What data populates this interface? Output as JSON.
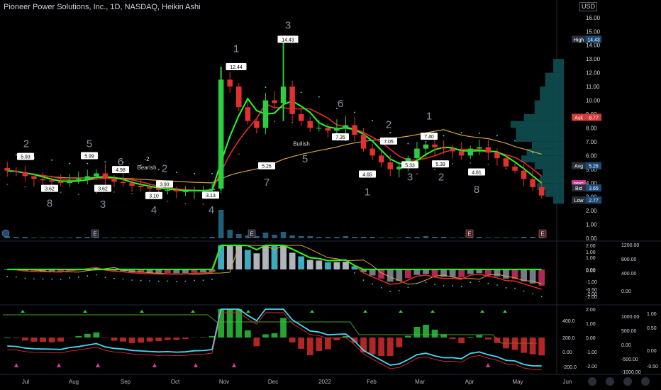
{
  "header": {
    "title": "Pioneer Power Solutions, Inc., 1D, NASDAQ, Heikin Ashi",
    "currency": "USD"
  },
  "colors": {
    "background": "#000000",
    "up": "#2ecc40",
    "down": "#e03030",
    "ma_green": "#22ff22",
    "ma_red": "#e52b2b",
    "ma_orange": "#d6a444",
    "dots_cyan": "#48c8e0",
    "dots_red": "#d03030",
    "volume_profile": "#0e4f52",
    "label_blue": "#1e4a78",
    "label_red": "#d43b3b",
    "label_pink": "#d93a9a",
    "label_gray": "#2a2e39"
  },
  "chart_data": [
    {
      "type": "candlestick",
      "name": "main",
      "style": "Heikin Ashi",
      "ylim": [
        0,
        16.5
      ],
      "y_ticks": [
        "16.00",
        "15.00",
        "14.00",
        "13.00",
        "12.00",
        "11.00",
        "10.00",
        "9.00",
        "8.00",
        "7.00",
        "6.00",
        "5.00",
        "4.00",
        "3.00",
        "2.00",
        "1.00",
        "0.00"
      ],
      "x_ticks": [
        "Jul",
        "Aug",
        "Sep",
        "Oct",
        "Nov",
        "Dec",
        "2022",
        "Feb",
        "Mar",
        "Apr",
        "May",
        "Jun"
      ],
      "price_close": [
        4.9,
        4.8,
        4.5,
        4.3,
        4.2,
        4.1,
        4.0,
        4.2,
        4.3,
        4.5,
        4.7,
        4.3,
        4.1,
        4.0,
        3.8,
        3.7,
        3.6,
        3.5,
        3.5,
        3.4,
        3.4,
        3.5,
        3.5,
        3.6,
        11.5,
        11.0,
        9.5,
        8.5,
        8.0,
        10.0,
        9.8,
        11.0,
        9.0,
        8.5,
        8.0,
        8.0,
        7.8,
        8.0,
        8.2,
        7.5,
        6.5,
        6.0,
        5.5,
        5.0,
        5.2,
        5.8,
        6.5,
        6.8,
        6.6,
        6.5,
        6.3,
        6.0,
        6.5,
        6.6,
        6.2,
        5.8,
        5.2,
        4.9,
        4.3,
        3.7,
        3.1
      ],
      "price_labels": [
        {
          "text": "5.93",
          "price": 5.93
        },
        {
          "text": "3.62",
          "price": 3.62
        },
        {
          "text": "5.99",
          "price": 5.99
        },
        {
          "text": "3.62",
          "price": 3.62
        },
        {
          "text": "4.98",
          "price": 4.98
        },
        {
          "text": "3.93",
          "price": 3.93
        },
        {
          "text": "3.10",
          "price": 3.1
        },
        {
          "text": "3.13",
          "price": 3.13
        },
        {
          "text": "12.44",
          "price": 12.44
        },
        {
          "text": "14.43",
          "price": 14.43
        },
        {
          "text": "5.26",
          "price": 5.26
        },
        {
          "text": "7.35",
          "price": 7.35
        },
        {
          "text": "4.65",
          "price": 4.65
        },
        {
          "text": "7.05",
          "price": 7.05
        },
        {
          "text": "5.33",
          "price": 5.33
        },
        {
          "text": "7.40",
          "price": 7.4
        },
        {
          "text": "5.39",
          "price": 5.39
        },
        {
          "text": "4.81",
          "price": 4.81
        }
      ],
      "wave_labels": [
        "2",
        "8",
        "5",
        "3",
        "6",
        "4",
        "2",
        "4",
        "1",
        "7",
        "3",
        "5",
        "6",
        "1",
        "2",
        "3",
        "1",
        "2",
        "8"
      ],
      "annotations": [
        "-2",
        "Bearish",
        "Bullish"
      ],
      "markers": [
        "E",
        "E",
        "E",
        "E"
      ],
      "price_tags": [
        {
          "label": "High",
          "value": "14.43",
          "price": 14.43
        },
        {
          "label": "Ask",
          "value": "8.77",
          "price": 8.77
        },
        {
          "label": "Avg",
          "value": "5.26",
          "price": 5.26
        },
        {
          "label": "PPG",
          "value": "",
          "price": 3.95
        },
        {
          "label": "Bid",
          "value": "3.65",
          "price": 3.65
        },
        {
          "label": "Low",
          "value": "2.77",
          "price": 2.77
        }
      ]
    },
    {
      "type": "line",
      "name": "oscillator-1",
      "y_ticks_left": [
        "2.00",
        "1.00",
        "0.00",
        "-1.00",
        "-2.00"
      ],
      "y_ticks_mid": [
        "1.00",
        "0.00",
        "-2.00",
        "-0.50"
      ],
      "y_ticks_right": [
        "1200.00",
        "800.00",
        "400.00",
        "0.00"
      ]
    },
    {
      "type": "line",
      "name": "oscillator-2",
      "y_ticks_left": [
        "2.00",
        "1.00",
        "0.00",
        "-1.00",
        "-2.00"
      ],
      "y_ticks_mid": [
        "400.0",
        "200.0",
        "0.00",
        "-200.0"
      ],
      "y_ticks_mid2": [
        "1000.00",
        "500.00",
        "0.00",
        "-500.00",
        "-1000.00"
      ],
      "y_ticks_right": [
        "1.00",
        "0.50",
        "0.00",
        "-0.50"
      ]
    }
  ]
}
